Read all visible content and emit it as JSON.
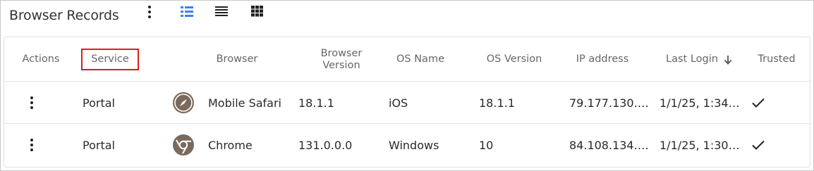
{
  "header": {
    "title": "Browser Records",
    "more_icon": "kebab-vertical-icon",
    "view_icons": [
      "list-detail-icon",
      "list-icon",
      "grid-icon"
    ],
    "active_view_color": "#3b82f6"
  },
  "table": {
    "columns": [
      {
        "key": "actions",
        "label": "Actions"
      },
      {
        "key": "service",
        "label": "Service"
      },
      {
        "key": "browser",
        "label": "Browser"
      },
      {
        "key": "browser_version",
        "label": "Browser Version"
      },
      {
        "key": "os_name",
        "label": "OS Name"
      },
      {
        "key": "os_version",
        "label": "OS Version"
      },
      {
        "key": "ip_address",
        "label": "IP address"
      },
      {
        "key": "last_login",
        "label": "Last Login",
        "sort": "descending"
      },
      {
        "key": "trusted",
        "label": "Trusted"
      }
    ],
    "highlight_color": "#e01c1c",
    "rows": [
      {
        "service": "Portal",
        "browser_icon": "safari-compass-icon",
        "browser": "Mobile Safari",
        "browser_version": "18.1.1",
        "os_name": "iOS",
        "os_version": "18.1.1",
        "ip_address": "79.177.130.…",
        "last_login": "1/1/25, 1:34…",
        "trusted_icon": "checkmark-icon"
      },
      {
        "service": "Portal",
        "browser_icon": "chrome-icon",
        "browser": "Chrome",
        "browser_version": "131.0.0.0",
        "os_name": "Windows",
        "os_version": "10",
        "ip_address": "84.108.134.…",
        "last_login": "1/1/25, 1:30…",
        "trusted_icon": "checkmark-icon"
      }
    ]
  }
}
